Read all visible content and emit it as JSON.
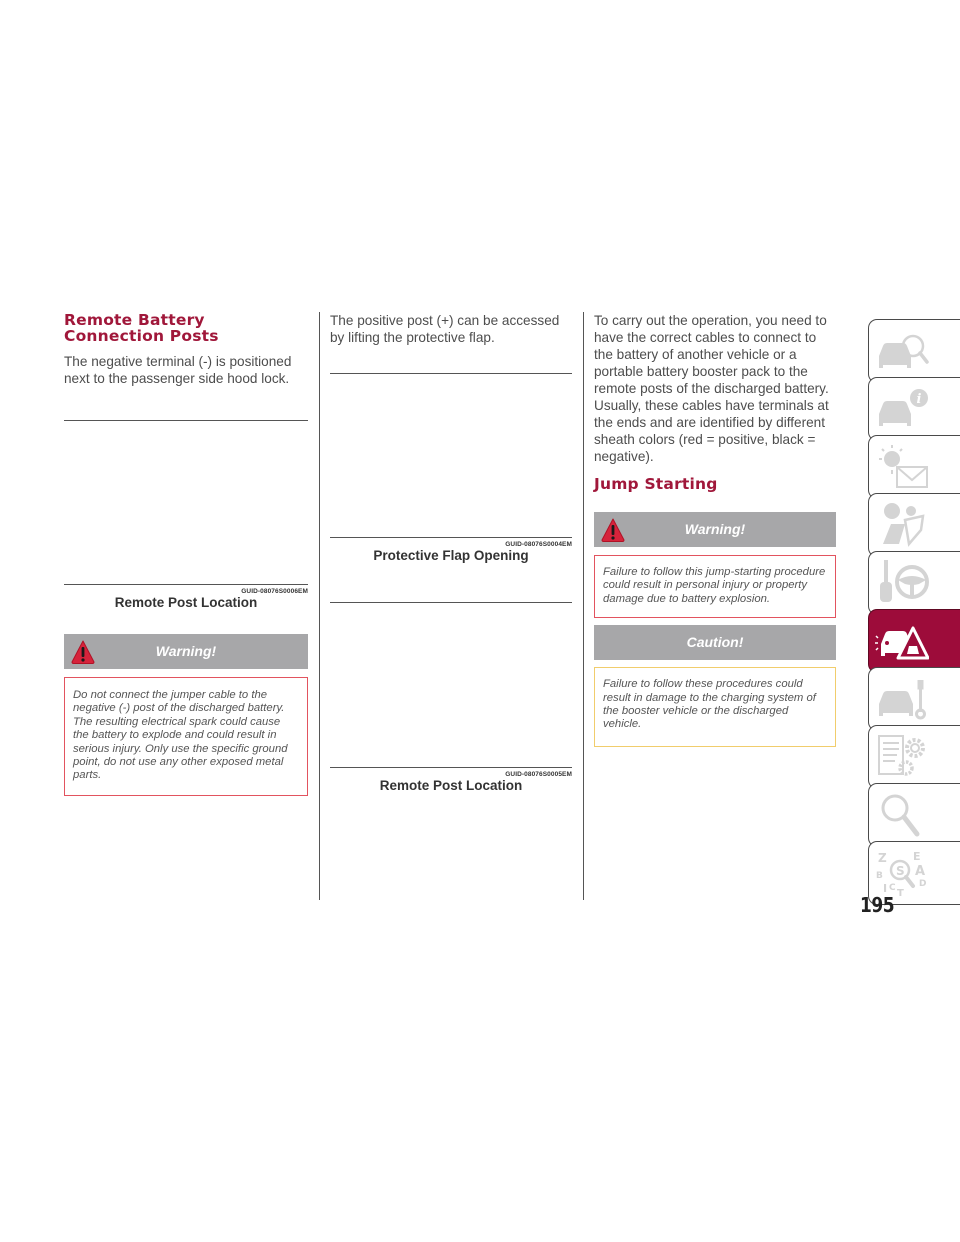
{
  "page_number": "195",
  "column1": {
    "heading": "Remote Battery Connection Posts",
    "heading_line1": "Remote Battery",
    "heading_line2": "Connection Posts",
    "paragraph": "The negative terminal (-) is positioned next to the passenger side hood lock.",
    "figure": {
      "guid": "GUID-08076S0006EM",
      "caption": "Remote Post Location"
    },
    "warning": {
      "title": "Warning!",
      "icon": "warning-triangle-icon",
      "text": "Do not connect the jumper cable to the negative (-) post of the discharged battery. The resulting electrical spark could cause the battery to explode and could result in serious injury. Only use the specific ground point, do not use any other exposed metal parts."
    }
  },
  "column2": {
    "paragraph": "The positive post (+) can be accessed by lifting the protective flap.",
    "figure1": {
      "guid": "GUID-08076S0004EM",
      "caption": "Protective Flap Opening"
    },
    "figure2": {
      "guid": "GUID-08076S0005EM",
      "caption": "Remote Post Location"
    }
  },
  "column3": {
    "paragraph": "To carry out the operation, you need to have the correct cables to connect to the battery of another vehicle or a portable battery booster pack to the remote posts of the discharged battery. Usually, these cables have terminals at the ends and are identified by different sheath colors (red = positive, black = negative).",
    "heading": "Jump Starting",
    "warning": {
      "title": "Warning!",
      "icon": "warning-triangle-icon",
      "text": "Failure to follow this jump-starting procedure could result in personal injury or property damage due to battery explosion."
    },
    "caution": {
      "title": "Caution!",
      "text": "Failure to follow these procedures could result in damage to the charging system of the booster vehicle or the discharged vehicle."
    }
  },
  "sidebar": {
    "tabs": [
      {
        "icon": "car-magnifier-icon",
        "active": false
      },
      {
        "icon": "car-info-icon",
        "active": false
      },
      {
        "icon": "warning-light-message-icon",
        "active": false
      },
      {
        "icon": "airbag-seatbelt-icon",
        "active": false
      },
      {
        "icon": "key-steering-wheel-icon",
        "active": false
      },
      {
        "icon": "car-breakdown-triangle-icon",
        "active": true
      },
      {
        "icon": "car-wrench-icon",
        "active": false
      },
      {
        "icon": "specs-gears-icon",
        "active": false
      },
      {
        "icon": "search-icon",
        "active": false
      },
      {
        "icon": "index-alphabet-icon",
        "active": false
      }
    ],
    "index_letters": [
      "Z",
      "E",
      "A",
      "B",
      "D",
      "I",
      "C",
      "T"
    ]
  },
  "colors": {
    "heading": "#a0173a",
    "alert_header": "#a7a7a9",
    "warning_border": "#e2535f",
    "caution_border": "#f1cd6c",
    "active_tab": "#9d0c3a",
    "icon_gray": "#d4d4d4"
  }
}
